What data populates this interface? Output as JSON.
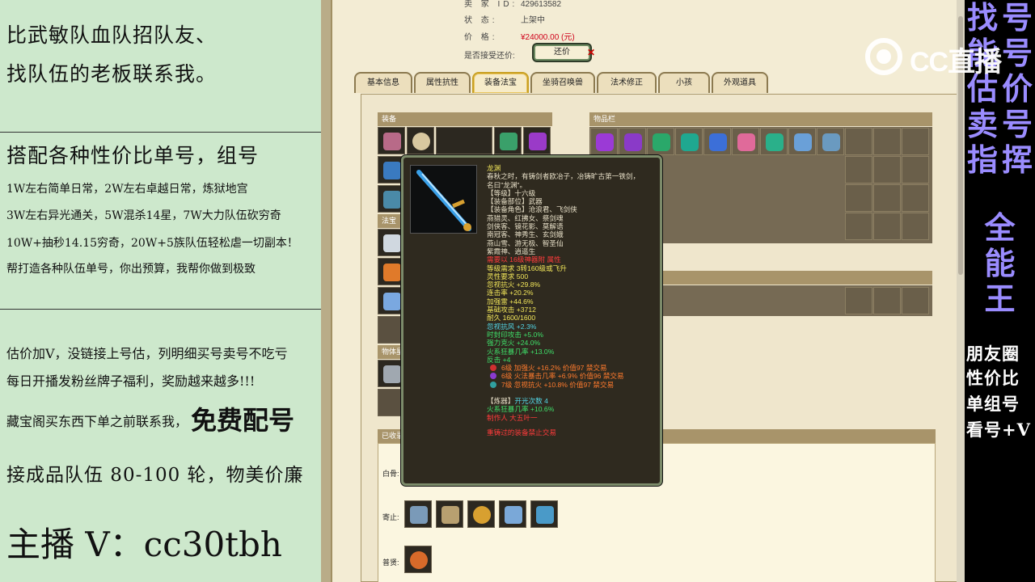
{
  "left_panel": {
    "line1": "比武敏队血队招队友、",
    "line2": "找队伍的老板联系我。",
    "line3": "搭配各种性价比单号，组号",
    "line4": "1W左右简单日常，2W左右卓越日常，炼狱地宫",
    "line5": "3W左右异光通关，5W混杀14星，7W大力队伍砍穷奇",
    "line6": "10W+抽秒14.15穷奇，20W+5族队伍轻松虐一切副本！",
    "line7": "帮打造各种队伍单号，你出预算，我帮你做到极致",
    "line8": "估价加V，没链接上号估，列明细买号卖号不吃亏",
    "line9": "每日开播发粉丝牌子福利，奖励越来越多!!!",
    "line10": "藏宝阁买东西下单之前联系我，",
    "line10_big": "免费配号",
    "line11": "接成品队伍 80-100 轮，物美价廉",
    "line12": "主播 V：cc30tbh"
  },
  "game": {
    "info": {
      "seller_id_label": "卖 家 ID:",
      "seller_id": "429613582",
      "status_label": "状 态:",
      "status": "上架中",
      "price_label": "价 格:",
      "price": "¥24000.00 (元)",
      "counter_label": "是否接受还价:",
      "counter_button": "还价"
    },
    "tabs": [
      "基本信息",
      "属性抗性",
      "装备法宝",
      "坐骑召唤兽",
      "法术修正",
      "小孩",
      "外观道具"
    ],
    "sections": {
      "equip": "装备",
      "items": "物品栏",
      "fabao": "法宝",
      "gems": "物体星盘",
      "sold": "已收录的"
    },
    "sold_rows": {
      "row1": "白骨:",
      "row2": "寄止:",
      "row3": "普贤:"
    }
  },
  "tooltip": {
    "name": "龙渊",
    "desc1": "春秋之时，有铸剑者欧冶子，冶铸旷古第一铁剑，",
    "desc2": "名曰\"龙渊\"。",
    "level": "【等级】十六级",
    "part": "【装备部位】武器",
    "roles_label": "【装备角色】沧浪君、飞剑侠",
    "roles2": "燕猎灵、红拂女、祭剑魂",
    "roles3": "剑侠客、镜花影、莫解语",
    "roles4": "南冠客、神秀生、玄剑娥",
    "roles5": "燕山雪、游无极、智圣仙",
    "roles6": "紫霞神、逍遥生",
    "special": "需要以 16级神器附 属性",
    "req_level": "等级需求 3转160级或飞升",
    "req_spirit": "灵性要求 500",
    "stat1": "忽视抗火 +29.8%",
    "stat2": "连击率 +20.2%",
    "stat3": "加强雷 +44.6%",
    "stat4": "基础攻击 +3712",
    "stat5": "耐久 1600/1600",
    "stat6": "忽视抗风 +2.3%",
    "stat7": "时封印攻击 +5.0%",
    "stat8": "强力克火 +24.0%",
    "stat9": "火系狂暴几率 +13.0%",
    "stat10": "反击 +4",
    "gem1": "6级 加强火 +16.2% 价值97 禁交易",
    "gem2": "6级 火法暴击几率 +6.9% 价值96 禁交易",
    "gem3": "7级 忽视抗火 +10.8% 价值97 禁交易",
    "refine_label": "【炼器】",
    "refine_value": "开光次数 4",
    "refine_stat": "火系狂暴几率 +10.6%",
    "maker": "制作人 大五叶一",
    "bind": "重铸过的装备禁止交易",
    "colors": {
      "name": "#f2e65a",
      "green": "#3fe06a",
      "cyan": "#53d6e6",
      "red": "#ff3b3b",
      "orange": "#ff7b2e"
    }
  },
  "right_panel": {
    "col1": [
      "找",
      "能",
      "估",
      "卖",
      "指"
    ],
    "col2": [
      "号",
      "号",
      "价",
      "号",
      "挥"
    ],
    "center": [
      "全",
      "能",
      "王"
    ],
    "small1": "朋友圈",
    "small2": "性价比",
    "small3": "单组号",
    "small4": "看号+V"
  },
  "watermark": {
    "text": "CC直播"
  },
  "icons": {
    "equip": [
      "helmet-icon",
      "necklace-icon",
      "armor-icon",
      "mask-icon",
      "belt-icon",
      "weapon-icon",
      "boots-icon"
    ],
    "items_colors": [
      "#9b3ad6",
      "#8a3ac8",
      "#2aa86a",
      "#1fa890",
      "#3c6fd8",
      "#e06a9a",
      "#2ab08a",
      "#6aa0d8",
      "#6a9ac0"
    ]
  }
}
